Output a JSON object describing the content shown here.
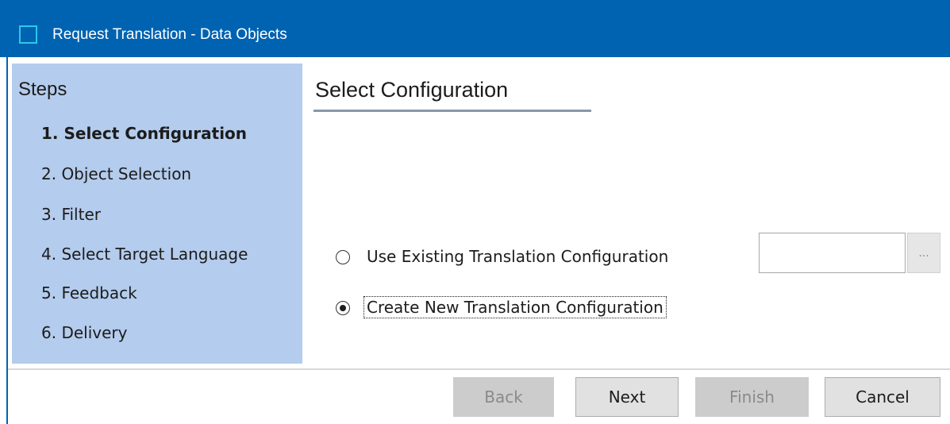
{
  "window": {
    "title": "Request Translation - Data Objects"
  },
  "steps": {
    "heading": "Steps",
    "items": [
      {
        "label": "1. Select Configuration",
        "active": true
      },
      {
        "label": "2. Object Selection",
        "active": false
      },
      {
        "label": "3. Filter",
        "active": false
      },
      {
        "label": "4. Select Target Language",
        "active": false
      },
      {
        "label": "5. Feedback",
        "active": false
      },
      {
        "label": "6. Delivery",
        "active": false
      }
    ]
  },
  "main": {
    "title": "Select Configuration",
    "options": [
      {
        "label": "Use Existing Translation Configuration",
        "selected": false
      },
      {
        "label": "Create New Translation Configuration",
        "selected": true
      }
    ],
    "config_input_value": "",
    "browse_label": "..."
  },
  "buttons": {
    "back": {
      "label": "Back",
      "enabled": false
    },
    "next": {
      "label": "Next",
      "enabled": true
    },
    "finish": {
      "label": "Finish",
      "enabled": false
    },
    "cancel": {
      "label": "Cancel",
      "enabled": true
    }
  },
  "colors": {
    "title_bar": "#0063b1",
    "steps_panel": "#b4cced",
    "disabled_button": "#cccccc",
    "enabled_button": "#e1e1e1"
  },
  "icons": {
    "app_icon": "window-icon"
  }
}
